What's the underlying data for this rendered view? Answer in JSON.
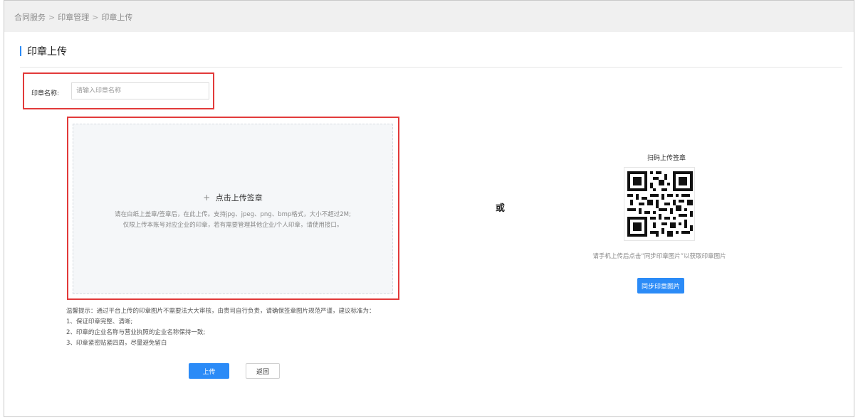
{
  "breadcrumb": {
    "items": [
      "合同服务",
      "印章管理",
      "印章上传"
    ],
    "separator": ">"
  },
  "page": {
    "title": "印章上传"
  },
  "form": {
    "name_label": "印章名称:",
    "name_placeholder": "请输入印章名称",
    "name_value": ""
  },
  "upload": {
    "title": "点击上传签章",
    "plus_icon": "+",
    "desc_line1": "请在白纸上盖章/签章后，在此上传。支持jpg、jpeg、png、bmp格式，大小不超过2M;",
    "desc_line2": "仅限上传本账号对应企业的印章，若有需要管理其他企业/个人印章，请使用接口。"
  },
  "or_text": "或",
  "qr": {
    "title": "扫码上传签章",
    "hint": "请手机上传后点击“同步印章图片”以获取印章图片",
    "sync_button": "同步印章图片"
  },
  "tips": {
    "line0": "温馨提示：通过平台上传的印章图片不需要法大大审核，由贵司自行负责，请确保签章图片规范严谨，建议标准为：",
    "line1": "1、保证印章完整、清晰;",
    "line2": "2、印章的企业名称与营业执照的企业名称保持一致;",
    "line3": "3、印章紧密贴紧四周，尽量避免留白"
  },
  "actions": {
    "upload": "上传",
    "back": "返回"
  },
  "colors": {
    "accent": "#2b8bf7",
    "highlight": "#e23a3a"
  }
}
